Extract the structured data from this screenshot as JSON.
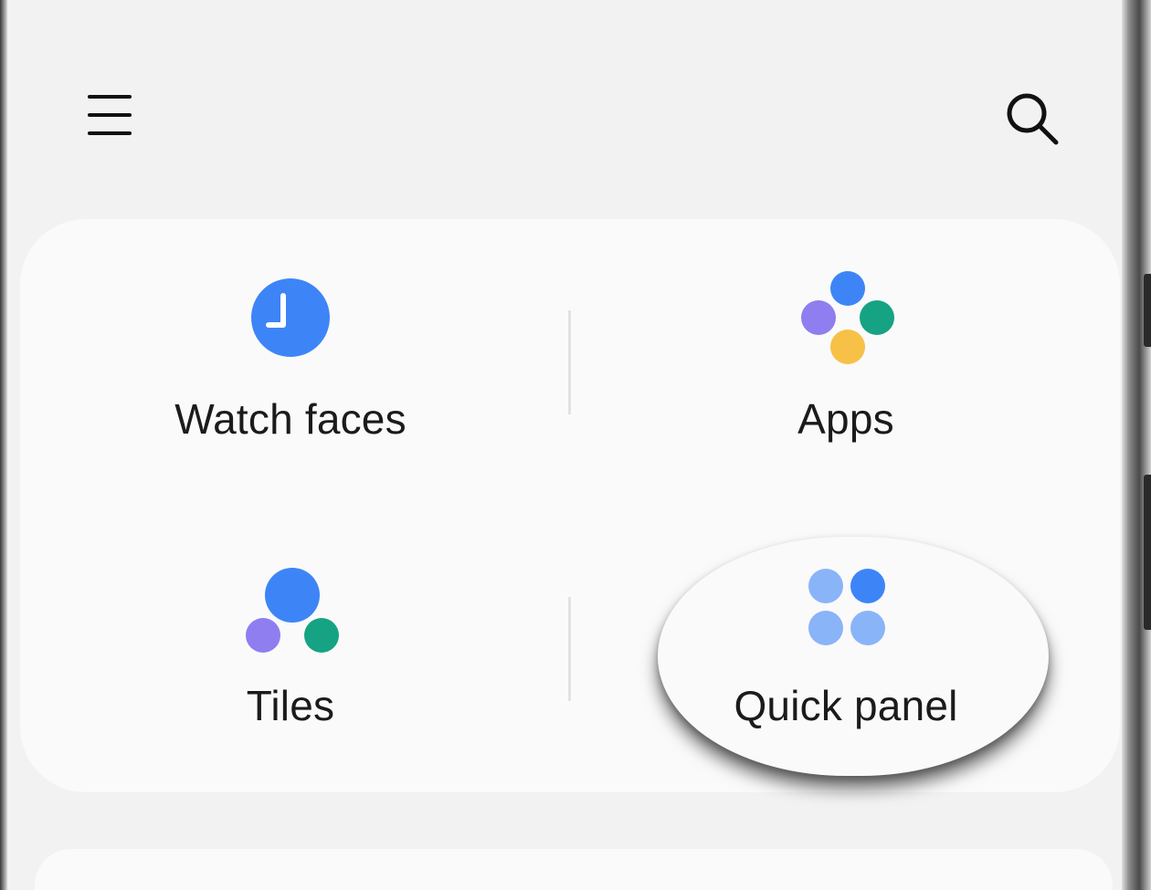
{
  "header": {
    "menu_icon": "hamburger-menu-icon",
    "search_icon": "search-icon"
  },
  "grid": {
    "items": [
      {
        "label": "Watch faces",
        "icon": "clock-icon"
      },
      {
        "label": "Apps",
        "icon": "apps-dots-icon"
      },
      {
        "label": "Tiles",
        "icon": "tiles-icon"
      },
      {
        "label": "Quick panel",
        "icon": "quick-panel-icon"
      }
    ]
  },
  "colors": {
    "background": "#f2f2f2",
    "card": "#fafafa",
    "blue": "#3d85f7",
    "light_blue": "#8ab4f8",
    "purple": "#8e7ef0",
    "green": "#15a383",
    "yellow": "#f7c047"
  }
}
